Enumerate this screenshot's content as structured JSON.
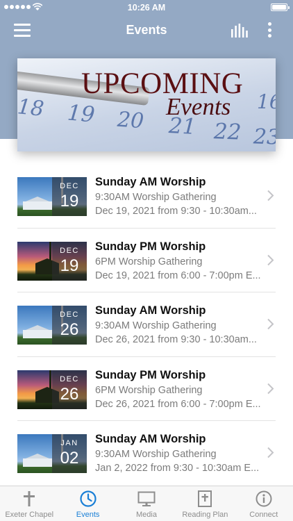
{
  "status_bar": {
    "time": "10:26 AM"
  },
  "nav": {
    "title": "Events"
  },
  "banner": {
    "line1": "UPCOMING",
    "line2": "Events",
    "calendar_numbers": [
      "18",
      "19",
      "20",
      "21",
      "22",
      "23",
      "16"
    ]
  },
  "events": [
    {
      "title": "Sunday AM Worship",
      "subtitle": "9:30AM Worship Gathering",
      "when": "Dec 19, 2021 from 9:30 - 10:30am...",
      "month": "DEC",
      "day": "19",
      "image": "day"
    },
    {
      "title": "Sunday PM Worship",
      "subtitle": "6PM Worship Gathering",
      "when": "Dec 19, 2021 from 6:00 - 7:00pm E...",
      "month": "DEC",
      "day": "19",
      "image": "dusk"
    },
    {
      "title": "Sunday AM Worship",
      "subtitle": "9:30AM Worship Gathering",
      "when": "Dec 26, 2021 from 9:30 - 10:30am...",
      "month": "DEC",
      "day": "26",
      "image": "day"
    },
    {
      "title": "Sunday PM Worship",
      "subtitle": "6PM Worship Gathering",
      "when": "Dec 26, 2021 from 6:00 - 7:00pm E...",
      "month": "DEC",
      "day": "26",
      "image": "dusk"
    },
    {
      "title": "Sunday AM Worship",
      "subtitle": "9:30AM Worship Gathering",
      "when": "Jan 2, 2022 from 9:30 - 10:30am E...",
      "month": "JAN",
      "day": "02",
      "image": "day"
    }
  ],
  "tabs": [
    {
      "label": "Exeter Chapel",
      "icon": "cross-icon",
      "active": false
    },
    {
      "label": "Events",
      "icon": "clock-icon",
      "active": true
    },
    {
      "label": "Media",
      "icon": "monitor-icon",
      "active": false
    },
    {
      "label": "Reading Plan",
      "icon": "bible-icon",
      "active": false
    },
    {
      "label": "Connect",
      "icon": "info-icon",
      "active": false
    }
  ],
  "colors": {
    "header": "#94a9c4",
    "accent": "#1a7fd6",
    "tab_inactive": "#8d8d8d",
    "banner_text": "#5b0f12"
  }
}
